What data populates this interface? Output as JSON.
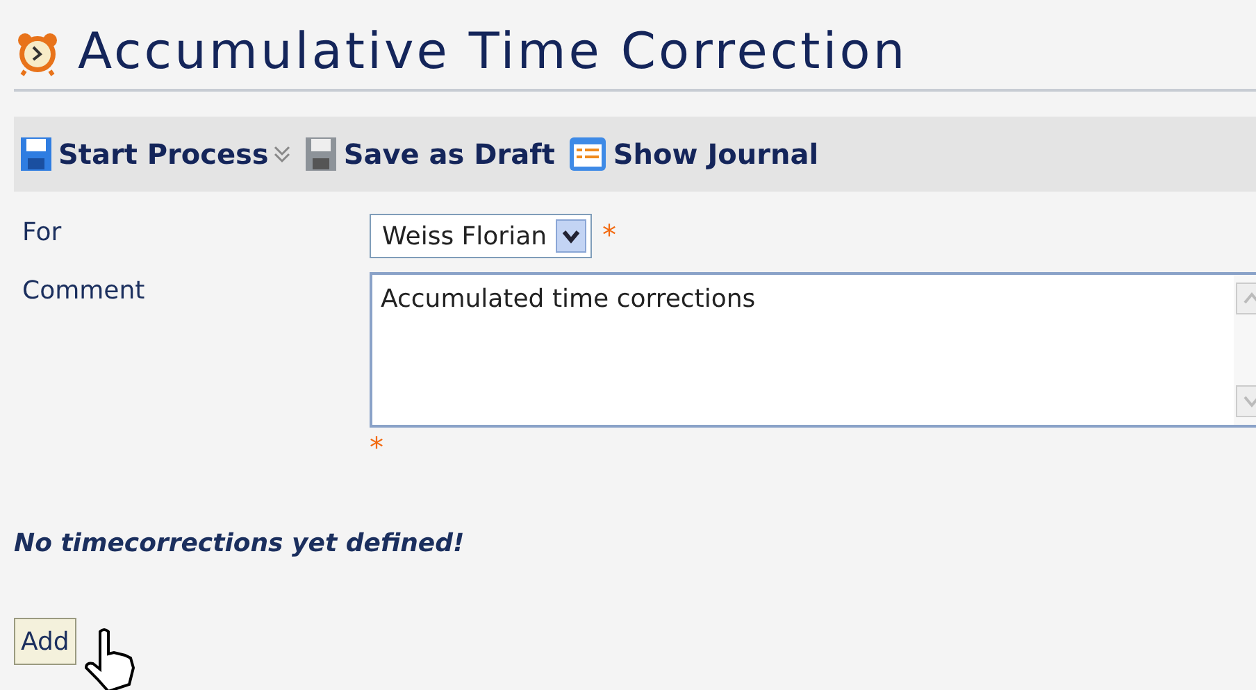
{
  "title": "Accumulative Time Correction",
  "toolbar": [
    {
      "kind": "start",
      "label": "Start Process",
      "dropdown": true
    },
    {
      "kind": "save",
      "label": "Save as Draft",
      "dropdown": false
    },
    {
      "kind": "journal",
      "label": "Show Journal",
      "dropdown": false
    }
  ],
  "form": {
    "for": {
      "label": "For",
      "value": "Weiss Florian",
      "required_mark": "*"
    },
    "comment": {
      "label": "Comment",
      "value": "Accumulated time corrections",
      "required_mark": "*"
    }
  },
  "message": "No timecorrections yet defined!",
  "add_button": "Add"
}
